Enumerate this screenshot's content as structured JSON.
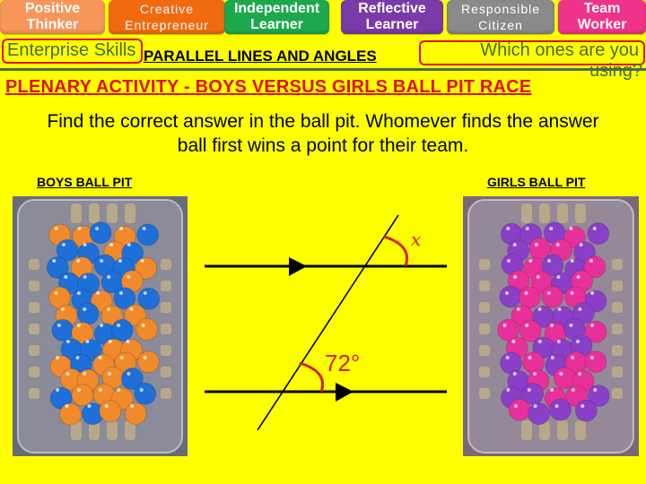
{
  "skills": [
    {
      "label": "Positive\nThinker",
      "color": "#f7955a",
      "style": "bold"
    },
    {
      "label": "Creative\nEntrepreneur",
      "color": "#f26a10",
      "style": "thin"
    },
    {
      "label": "Independent\nLearner",
      "color": "#1ea84e",
      "style": "bold"
    },
    {
      "label": "Reflective\nLearner",
      "color": "#7a3aa8",
      "style": "bold"
    },
    {
      "label": "Responsible\nCitizen",
      "color": "#8a8a8a",
      "style": "thin"
    },
    {
      "label": "Team\nWorker",
      "color": "#f0338a",
      "style": "bold"
    }
  ],
  "enterprise_label": "Enterprise Skills",
  "which_prompt_line1": "Which ones are you",
  "which_prompt_line2": "using?",
  "lesson_title": "PARALLEL LINES AND ANGLES",
  "activity_title": "PLENARY ACTIVITY - BOYS VERSUS GIRLS BALL PIT RACE",
  "instructions": "Find the correct answer in the ball pit. Whomever finds the answer ball first wins a point for their team.",
  "boys_pit": {
    "label": "BOYS BALL PIT",
    "ball_colors": [
      "#f08a2a",
      "#1e6fd8"
    ],
    "basket_color": "#6a6b78"
  },
  "girls_pit": {
    "label": "GIRLS BALL PIT",
    "ball_colors": [
      "#e8309a",
      "#8a3fc8"
    ],
    "basket_color": "#7a6878"
  },
  "diagram": {
    "known_angle": "72°",
    "unknown_angle": "x",
    "line_color": "#000000",
    "angle_color": "#d81e10"
  }
}
